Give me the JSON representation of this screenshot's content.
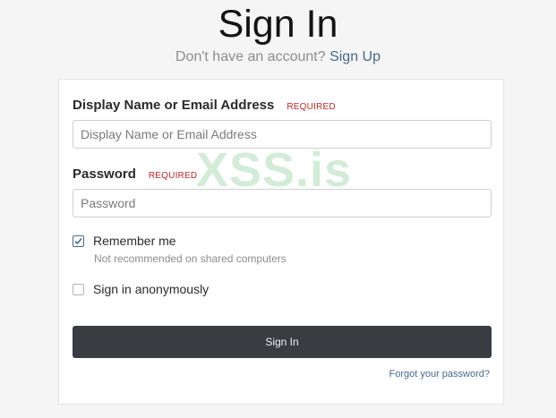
{
  "header": {
    "title": "Sign In",
    "no_account_text": "Don't have an account?",
    "signup_link": "Sign Up"
  },
  "form": {
    "login": {
      "label": "Display Name or Email Address",
      "required": "REQUIRED",
      "placeholder": "Display Name or Email Address",
      "value": ""
    },
    "password": {
      "label": "Password",
      "required": "REQUIRED",
      "placeholder": "Password",
      "value": ""
    },
    "remember_me": {
      "label": "Remember me",
      "hint": "Not recommended on shared computers",
      "checked": true
    },
    "anonymous": {
      "label": "Sign in anonymously",
      "checked": false
    },
    "submit_label": "Sign In",
    "forgot_link": "Forgot your password?"
  },
  "watermark": "XSS.is",
  "colors": {
    "background": "#f5f5f5",
    "link": "#47698a",
    "required": "#c0262b",
    "button": "#393d42",
    "watermark": "#82c88c"
  }
}
